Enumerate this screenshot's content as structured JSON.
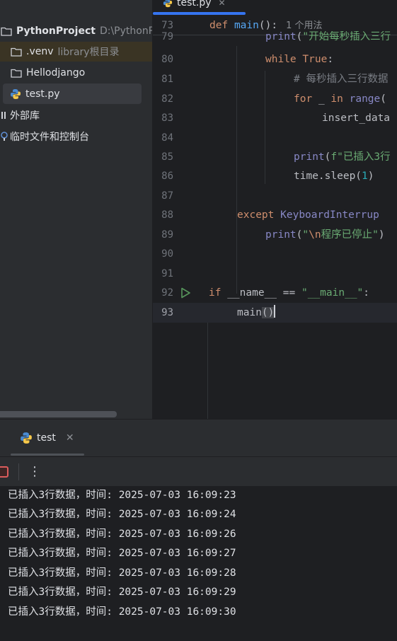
{
  "project": {
    "root_name": "PythonProject",
    "root_path": "D:\\PythonPr",
    "items": [
      {
        "name": ".venv",
        "hint": "library根目录"
      },
      {
        "name": "Hellodjango"
      },
      {
        "name": "test.py"
      }
    ],
    "external_libs": "外部库",
    "scratches": "临时文件和控制台"
  },
  "editor": {
    "tab_label": "test.py",
    "sticky": {
      "num": "73",
      "inlay": "1 个用法"
    },
    "lines": [
      {
        "num": "79"
      },
      {
        "num": "80"
      },
      {
        "num": "81"
      },
      {
        "num": "82"
      },
      {
        "num": "83"
      },
      {
        "num": "84"
      },
      {
        "num": "85"
      },
      {
        "num": "86"
      },
      {
        "num": "87"
      },
      {
        "num": "88"
      },
      {
        "num": "89"
      },
      {
        "num": "90"
      },
      {
        "num": "91"
      },
      {
        "num": "92"
      },
      {
        "num": "93"
      }
    ],
    "tokens": {
      "def": "def",
      "main": "main",
      "parens_colon": "():",
      "print": "print",
      "str_start": "\"开始每秒插入三行",
      "while": "while",
      "true": "True",
      "colon": ":",
      "comment": "# 每秒插入三行数据",
      "for": "for",
      "underscore": "_",
      "in": "in",
      "range": "range",
      "open_paren": "(",
      "insert": "insert_data",
      "fstr": "f\"已插入3行",
      "time_sleep": "time.sleep(",
      "one": "1",
      "close_paren": ")",
      "except": "except",
      "kbint": "KeyboardInterrup",
      "str_stop_open": "\"",
      "esc_n": "\\n",
      "str_stop_text": "程序已停止\"",
      "if": "if",
      "name_var": "__name__",
      "eq": "==",
      "main_str": "\"__main__\"",
      "call_main": "main",
      "call_open": "(",
      "call_close": ")"
    }
  },
  "run": {
    "tab_label": "test",
    "console_lines": [
      "已插入3行数据，时间: 2025-07-03 16:09:23",
      "已插入3行数据，时间: 2025-07-03 16:09:24",
      "已插入3行数据，时间: 2025-07-03 16:09:26",
      "已插入3行数据，时间: 2025-07-03 16:09:27",
      "已插入3行数据，时间: 2025-07-03 16:09:28",
      "已插入3行数据，时间: 2025-07-03 16:09:29",
      "已插入3行数据，时间: 2025-07-03 16:09:30"
    ]
  },
  "colors": {
    "accent": "#3574f0",
    "stop": "#db5c5c",
    "run_green": "#57965c"
  }
}
